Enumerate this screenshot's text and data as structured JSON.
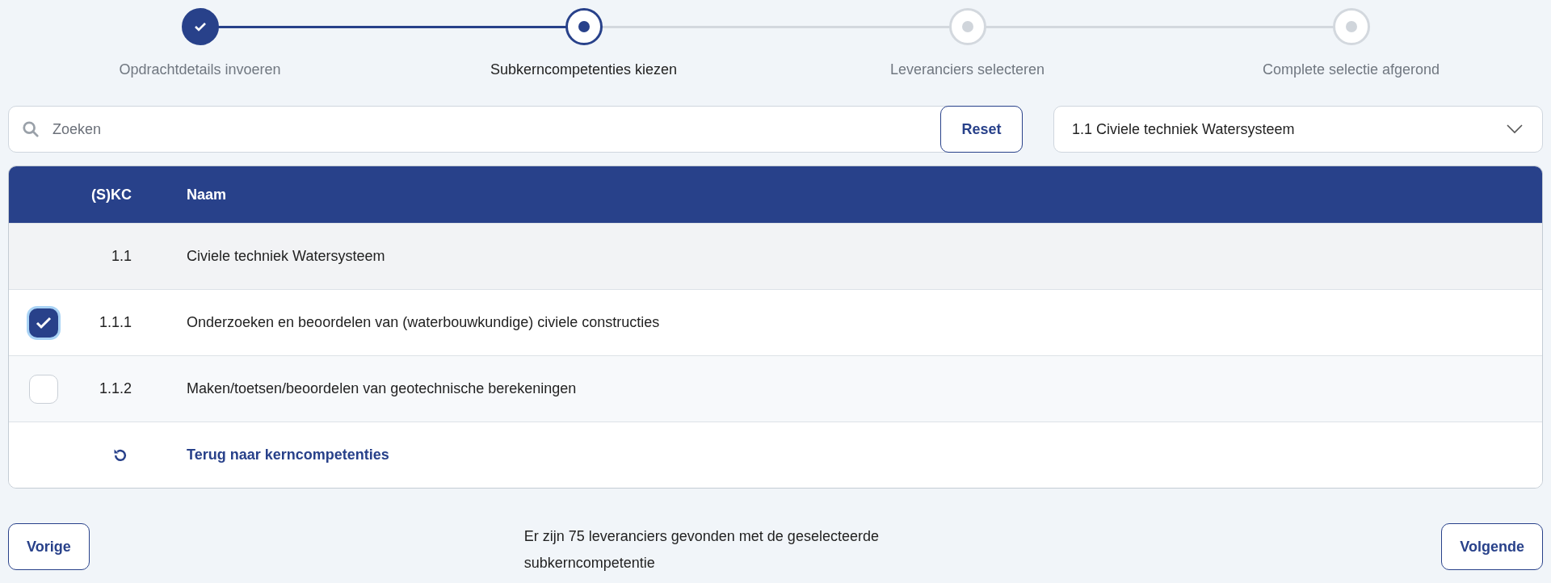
{
  "stepper": [
    {
      "label": "Opdrachtdetails invoeren",
      "kind": "done"
    },
    {
      "label": "Subkerncompetenties kiezen",
      "kind": "current"
    },
    {
      "label": "Leveranciers selecteren",
      "kind": "upcoming"
    },
    {
      "label": "Complete selectie afgerond",
      "kind": "upcoming"
    }
  ],
  "search": {
    "placeholder": "Zoeken"
  },
  "reset_button": "Reset",
  "category_select": {
    "value": "1.1 Civiele techniek Watersysteem"
  },
  "table": {
    "columns": [
      "(S)KC",
      "Naam"
    ],
    "rows": [
      {
        "kind": "group",
        "code": "1.1",
        "name": "Civiele techniek Watersysteem"
      },
      {
        "kind": "item",
        "code": "1.1.1",
        "name": "Onderzoeken en beoordelen van (waterbouwkundige) civiele constructies",
        "checked": true
      },
      {
        "kind": "item",
        "code": "1.1.2",
        "name": "Maken/toetsen/beoordelen van geotechnische berekeningen",
        "checked": false
      }
    ],
    "back_link": "Terug naar kerncompetenties"
  },
  "footer": {
    "previous": "Vorige",
    "message": "Er zijn 75 leveranciers gevonden met de geselecteerde subkerncompetentie",
    "next": "Volgende"
  }
}
